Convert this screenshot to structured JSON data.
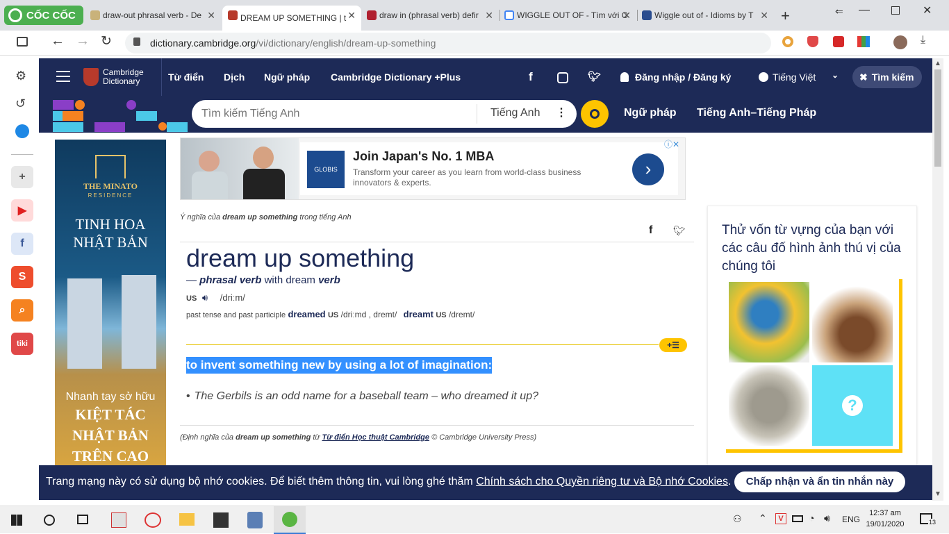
{
  "browser": {
    "brand": "CỐC CỐC",
    "tabs": [
      {
        "title": "draw-out phrasal verb - De"
      },
      {
        "title": "DREAM UP SOMETHING | t"
      },
      {
        "title": "draw in (phrasal verb) defir"
      },
      {
        "title": "WIGGLE OUT OF - Tìm với C"
      },
      {
        "title": "Wiggle out of - Idioms by T"
      }
    ],
    "url_host": "dictionary.cambridge.org",
    "url_path": "/vi/dictionary/english/dream-up-something"
  },
  "site": {
    "logo_line1": "Cambridge",
    "logo_line2": "Dictionary",
    "nav": [
      "Từ điển",
      "Dịch",
      "Ngữ pháp",
      "Cambridge Dictionary +Plus"
    ],
    "login": "Đăng nhập / Đăng ký",
    "language": "Tiếng Việt",
    "search_toggle": "Tìm kiếm",
    "search_placeholder": "Tìm kiếm Tiếng Anh",
    "search_lang": "Tiếng Anh",
    "subnav": [
      "Ngữ pháp",
      "Tiếng Anh–Tiếng Pháp"
    ]
  },
  "ad_left": {
    "brand": "THE MINATO",
    "brand_sub": "RESIDENCE",
    "headline1": "TINH HOA",
    "headline2": "NHẬT BẢN",
    "tagline": "Nhanh tay sở hữu",
    "cta1": "KIỆT TÁC",
    "cta2": "NHẬT BẢN",
    "cta3": "TRÊN CAO"
  },
  "ad_top": {
    "logo": "GLOBIS",
    "title": "Join Japan's No. 1 MBA",
    "body1": "Transform your career as you learn from world-class business",
    "body2": "innovators & experts."
  },
  "entry": {
    "meaning_prefix": "Ý nghĩa của",
    "meaning_term": "dream up something",
    "meaning_suffix": "trong tiếng Anh",
    "headword": "dream up something",
    "pos_dash": "—",
    "pos": "phrasal verb",
    "pos_with": "with dream",
    "pos_verb": "verb",
    "region": "US",
    "ipa": "/driːm/",
    "forms_label": "past tense and past participle",
    "form1": "dreamed",
    "form1_region": "US",
    "form1_ipa": "/driːmd , dremt/",
    "form2": "dreamt",
    "form2_region": "US",
    "form2_ipa": "/dremt/",
    "definition": "to invent something new by using a lot of imagination:",
    "example": "The Gerbils is an odd name for a baseball team – who dreamed it up?",
    "source_prefix": "(Định nghĩa của",
    "source_term": "dream up something",
    "source_from": "từ",
    "source_dict": "Từ điển Học thuật Cambridge",
    "source_suffix": "© Cambridge University Press)"
  },
  "quiz": {
    "title": "Thử vốn từ vựng của bạn với các câu đố hình ảnh thú vị của chúng tôi"
  },
  "cookie": {
    "text": "Trang mạng này có sử dụng bộ nhớ cookies. Để biết thêm thông tin, vui lòng ghé thăm",
    "link": "Chính sách cho Quyền riêng tư và Bộ nhớ Cookies",
    "button": "Chấp nhận và ẩn tin nhắn này"
  },
  "taskbar": {
    "lang": "ENG",
    "time": "12:37 am",
    "date": "19/01/2020",
    "notif_count": "13"
  },
  "colors": {
    "navy": "#1d2a57",
    "selection": "#3390ff",
    "accent_yellow": "#fec400"
  }
}
